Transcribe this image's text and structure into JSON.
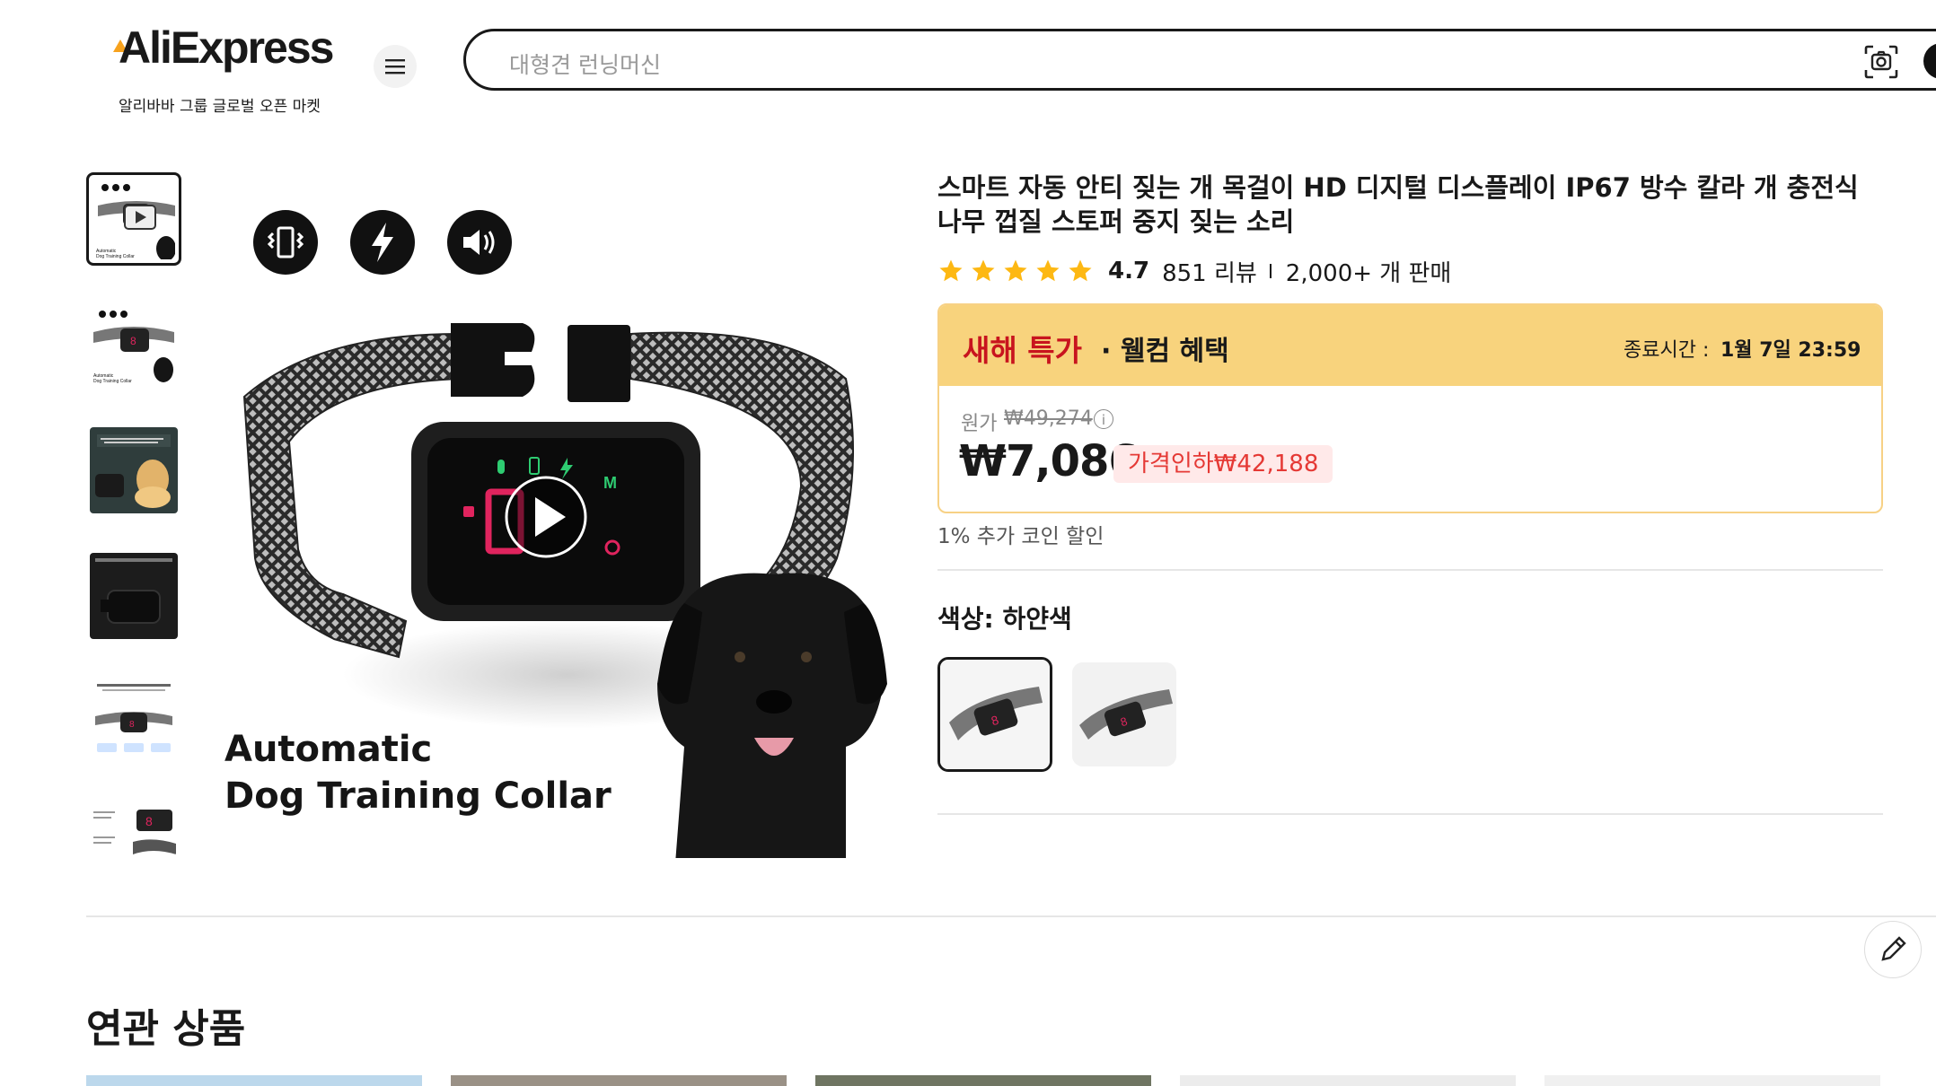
{
  "header": {
    "logo_text": "AliExpress",
    "logo_subtitle": "알리바바 그룹 글로벌 오픈 마켓",
    "menu_icon": "hamburger-icon",
    "search_placeholder": "대형견 런닝머신",
    "camera_icon": "camera-search-icon"
  },
  "gallery": {
    "main_image_line1": "Automatic",
    "main_image_line2": "Dog Training Collar",
    "icons": [
      "vibration-icon",
      "shock-icon",
      "sound-icon"
    ],
    "play_icon": "play-icon"
  },
  "product": {
    "title": "스마트 자동 안티 짖는 개 목걸이 HD 디지털 디스플레이 IP67 방수 칼라 개 충전식 나무 껍질 스토퍼 중지 짖는 소리",
    "rating": "4.7",
    "stars": 5,
    "reviews": "851 리뷰",
    "sold": "2,000+ 개 판매",
    "promo_title": "새해 특가",
    "promo_sub": "· 웰컴 혜택",
    "end_label": "종료시간 :",
    "end_time": "1월 7일 23:59",
    "original_label": "원가",
    "original_price": "₩49,274",
    "price": "₩7,086",
    "discount": "가격인하₩42,188",
    "coin_text": "1% 추가 코인 할인",
    "color_label": "색상: 하얀색"
  },
  "related": {
    "title": "연관 상품"
  },
  "colors": {
    "promo_bg": "#f8d37d",
    "promo_red": "#c8141e",
    "discount_bg": "#ffe9e9",
    "discount_text": "#e53935"
  }
}
